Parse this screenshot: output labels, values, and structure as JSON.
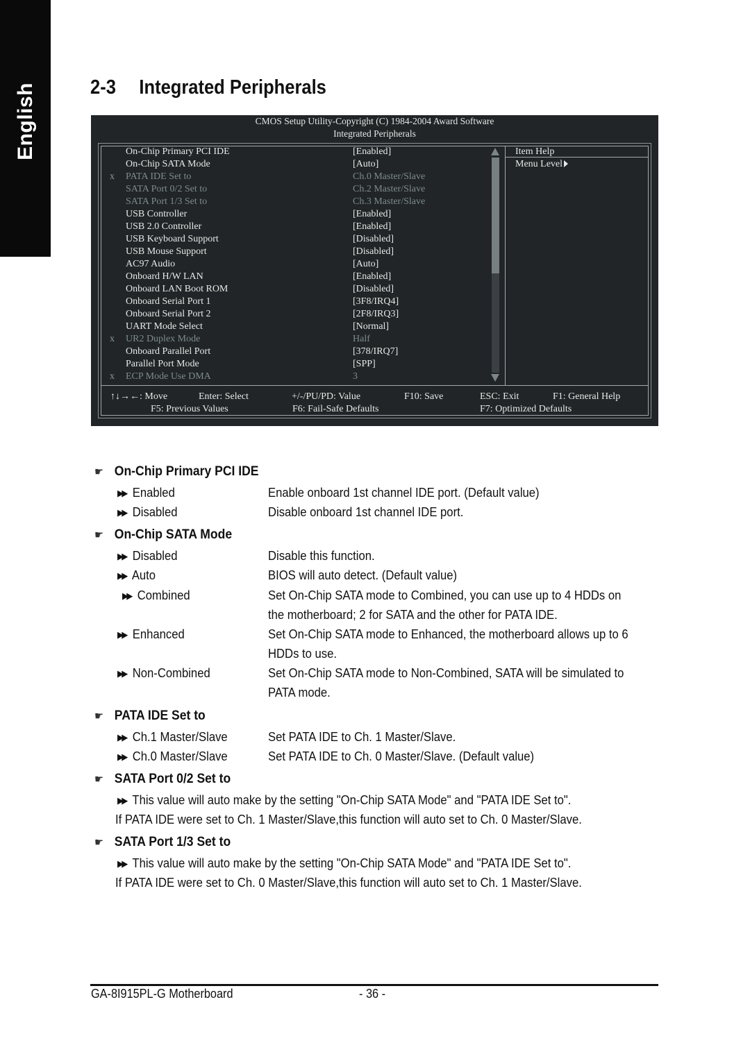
{
  "side_tab": {
    "label": "English"
  },
  "page": {
    "section_number": "2-3",
    "title": "Integrated Peripherals"
  },
  "bios": {
    "header_line1": "CMOS Setup Utility-Copyright (C) 1984-2004 Award Software",
    "header_line2": "Integrated Peripherals",
    "items": [
      {
        "mark": "",
        "label": "On-Chip Primary PCI IDE",
        "value": "[Enabled]",
        "disabled": false
      },
      {
        "mark": "",
        "label": "On-Chip SATA Mode",
        "value": "[Auto]",
        "disabled": false
      },
      {
        "mark": "x",
        "label": "PATA IDE Set to",
        "value": "Ch.0 Master/Slave",
        "disabled": true
      },
      {
        "mark": "",
        "label": "SATA Port 0/2 Set to",
        "value": "Ch.2 Master/Slave",
        "disabled": true
      },
      {
        "mark": "",
        "label": "SATA Port 1/3 Set to",
        "value": "Ch.3 Master/Slave",
        "disabled": true
      },
      {
        "mark": "",
        "label": "USB Controller",
        "value": "[Enabled]",
        "disabled": false
      },
      {
        "mark": "",
        "label": "USB 2.0 Controller",
        "value": "[Enabled]",
        "disabled": false
      },
      {
        "mark": "",
        "label": "USB Keyboard Support",
        "value": "[Disabled]",
        "disabled": false
      },
      {
        "mark": "",
        "label": "USB Mouse Support",
        "value": "[Disabled]",
        "disabled": false
      },
      {
        "mark": "",
        "label": "AC97 Audio",
        "value": "[Auto]",
        "disabled": false
      },
      {
        "mark": "",
        "label": "Onboard H/W LAN",
        "value": "[Enabled]",
        "disabled": false
      },
      {
        "mark": "",
        "label": "Onboard LAN Boot ROM",
        "value": "[Disabled]",
        "disabled": false
      },
      {
        "mark": "",
        "label": "Onboard Serial Port 1",
        "value": "[3F8/IRQ4]",
        "disabled": false
      },
      {
        "mark": "",
        "label": "Onboard Serial Port 2",
        "value": "[2F8/IRQ3]",
        "disabled": false
      },
      {
        "mark": "",
        "label": "UART Mode Select",
        "value": "[Normal]",
        "disabled": false
      },
      {
        "mark": "x",
        "label": "UR2 Duplex Mode",
        "value": "Half",
        "disabled": true
      },
      {
        "mark": "",
        "label": "Onboard Parallel Port",
        "value": "[378/IRQ7]",
        "disabled": false
      },
      {
        "mark": "",
        "label": "Parallel Port Mode",
        "value": "[SPP]",
        "disabled": false
      },
      {
        "mark": "x",
        "label": "ECP Mode Use DMA",
        "value": "3",
        "disabled": true
      }
    ],
    "help": {
      "title": "Item Help",
      "menu_level": "Menu Level"
    },
    "keys_row1": [
      {
        "text": "↑↓→←: Move"
      },
      {
        "text": "Enter: Select"
      },
      {
        "text": "+/-/PU/PD: Value"
      },
      {
        "text": "F10: Save"
      },
      {
        "text": "ESC: Exit"
      },
      {
        "text": "F1: General Help"
      }
    ],
    "keys_row2": [
      {
        "text": "F5: Previous Values"
      },
      {
        "text": "F6: Fail-Safe Defaults"
      },
      {
        "text": "F7: Optimized Defaults"
      }
    ]
  },
  "sections": {
    "primary_pci_ide": {
      "title": "On-Chip Primary PCI IDE",
      "options": [
        {
          "name": "Enabled",
          "desc": "Enable onboard 1st channel IDE port. (Default value)"
        },
        {
          "name": "Disabled",
          "desc": "Disable onboard 1st channel IDE port."
        }
      ]
    },
    "sata_mode": {
      "title": "On-Chip SATA Mode",
      "options": [
        {
          "name": "Disabled",
          "desc": "Disable this function."
        },
        {
          "name": "Auto",
          "desc": "BIOS will auto detect. (Default value)"
        },
        {
          "name": "Combined",
          "desc": "Set On-Chip SATA mode to Combined, you can use up to 4 HDDs on",
          "desc2": "the motherboard; 2 for SATA and the other for PATA IDE."
        },
        {
          "name": "Enhanced",
          "desc": "Set On-Chip SATA mode to Enhanced, the motherboard allows up to 6",
          "desc2": "HDDs to use."
        },
        {
          "name": "Non-Combined",
          "desc": "Set On-Chip SATA mode to Non-Combined, SATA will be simulated to",
          "desc2": "PATA mode."
        }
      ]
    },
    "pata_ide": {
      "title": "PATA IDE Set to",
      "options": [
        {
          "name": "Ch.1 Master/Slave",
          "desc": "Set PATA IDE to Ch. 1 Master/Slave."
        },
        {
          "name": "Ch.0 Master/Slave",
          "desc": "Set PATA IDE to Ch. 0 Master/Slave. (Default value)"
        }
      ]
    },
    "sata_02": {
      "title": "SATA Port 0/2 Set to",
      "line1": "This value will auto make by the setting \"On-Chip SATA Mode\" and \"PATA IDE Set to\".",
      "line2": "If PATA IDE were set to Ch. 1 Master/Slave,this function will auto set to Ch. 0 Master/Slave."
    },
    "sata_13": {
      "title": "SATA Port 1/3 Set to",
      "line1": "This value will auto make by the setting \"On-Chip SATA Mode\" and \"PATA IDE Set to\".",
      "line2": "If PATA IDE were set to Ch. 0 Master/Slave,this function will auto set to Ch. 1 Master/Slave."
    }
  },
  "footer": {
    "product": "GA-8I915PL-G Motherboard",
    "page": "- 36 -"
  }
}
